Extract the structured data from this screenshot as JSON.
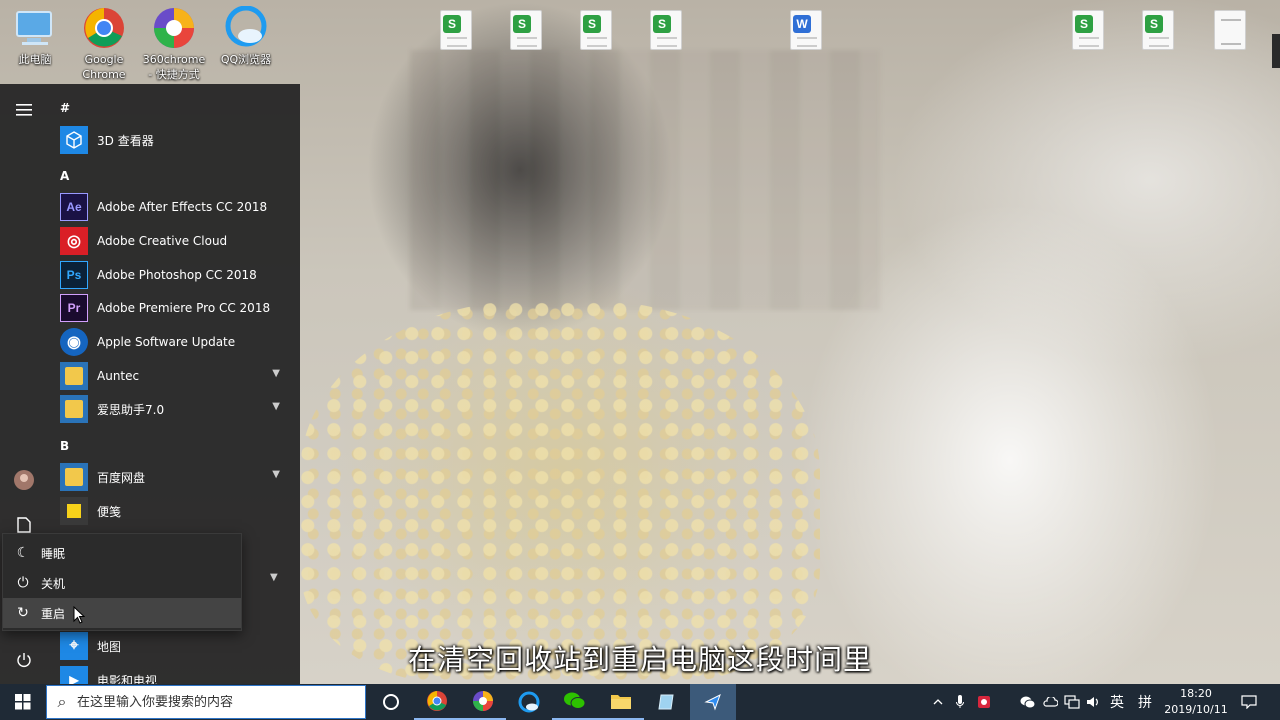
{
  "desktop": {
    "left_icons": [
      {
        "label": "此电脑",
        "icon": "computer-icon"
      },
      {
        "label": "Google Chrome",
        "icon": "chrome-icon"
      },
      {
        "label": "360chrome - 快捷方式",
        "icon": "360chrome-icon"
      },
      {
        "label": "QQ浏览器",
        "icon": "qq-browser-icon"
      }
    ],
    "docs": [
      {
        "badge": "S",
        "color": "#2ea043",
        "icon": "spreadsheet-file-icon"
      },
      {
        "badge": "S",
        "color": "#2ea043",
        "icon": "spreadsheet-file-icon"
      },
      {
        "badge": "S",
        "color": "#2ea043",
        "icon": "spreadsheet-file-icon"
      },
      {
        "badge": "S",
        "color": "#2ea043",
        "icon": "spreadsheet-file-icon"
      },
      {
        "badge": "W",
        "color": "#2f6fd6",
        "icon": "word-file-icon"
      },
      {
        "badge": "S",
        "color": "#2ea043",
        "icon": "spreadsheet-file-icon"
      },
      {
        "badge": "S",
        "color": "#2ea043",
        "icon": "spreadsheet-file-icon"
      },
      {
        "badge": "",
        "color": "#cccccc",
        "icon": "text-file-icon"
      }
    ]
  },
  "start_menu": {
    "groups": [
      {
        "header": "#",
        "apps": [
          {
            "label": "3D 查看器",
            "icon_text": "⬡",
            "icon_bg": "#1e88e5",
            "icon": "3d-viewer-icon",
            "expandable": false
          }
        ]
      },
      {
        "header": "A",
        "apps": [
          {
            "label": "Adobe After Effects CC 2018",
            "icon_text": "Ae",
            "icon_bg": "#1a1245",
            "icon_fg": "#9999ff",
            "icon": "after-effects-icon",
            "expandable": false
          },
          {
            "label": "Adobe Creative Cloud",
            "icon_text": "◎",
            "icon_bg": "#da1f26",
            "icon_fg": "#fff",
            "icon": "creative-cloud-icon",
            "expandable": false
          },
          {
            "label": "Adobe Photoshop CC 2018",
            "icon_text": "Ps",
            "icon_bg": "#0b2238",
            "icon_fg": "#31a8ff",
            "icon": "photoshop-icon",
            "expandable": false
          },
          {
            "label": "Adobe Premiere Pro CC 2018",
            "icon_text": "Pr",
            "icon_bg": "#1a0b2e",
            "icon_fg": "#d29ffc",
            "icon": "premiere-pro-icon",
            "expandable": false
          },
          {
            "label": "Apple Software Update",
            "icon_text": "◉",
            "icon_bg": "#1565c0",
            "icon_fg": "#fff",
            "icon": "apple-software-update-icon",
            "expandable": false
          },
          {
            "label": "Auntec",
            "icon_text": "",
            "icon_bg": "#f2c84b",
            "icon": "folder-icon",
            "expandable": true
          },
          {
            "label": "爱思助手7.0",
            "icon_text": "",
            "icon_bg": "#f2c84b",
            "icon": "folder-icon",
            "expandable": true
          }
        ]
      },
      {
        "header": "B",
        "apps": [
          {
            "label": "百度网盘",
            "icon_text": "",
            "icon_bg": "#f2c84b",
            "icon": "folder-icon",
            "expandable": true
          },
          {
            "label": "便笺",
            "icon_text": "▪",
            "icon_bg": "#f7d21a",
            "icon_fg": "#333",
            "icon": "sticky-notes-icon",
            "expandable": false
          }
        ]
      }
    ],
    "hidden_row_chevron": true,
    "bottom_apps": [
      {
        "label": "地图",
        "icon_text": "⌖",
        "icon_bg": "#1e88e5",
        "icon": "maps-icon"
      },
      {
        "label": "电影和电视",
        "icon_text": "▶",
        "icon_bg": "#1e88e5",
        "icon": "movies-tv-icon"
      }
    ],
    "power_menu": {
      "items": [
        {
          "label": "睡眠",
          "icon": "sleep-icon",
          "glyph": "☾"
        },
        {
          "label": "关机",
          "icon": "shutdown-icon",
          "glyph": "⏻"
        },
        {
          "label": "重启",
          "icon": "restart-icon",
          "glyph": "↻"
        }
      ],
      "hovered_index": 2
    }
  },
  "subtitle": "在清空回收站到重启电脑这段时间里",
  "taskbar": {
    "search_placeholder": "在这里输入你要搜索的内容",
    "apps": [
      "cortana-icon",
      "chrome-icon",
      "360chrome-icon",
      "edge-icon",
      "wechat-icon",
      "file-explorer-icon",
      "notepad-icon",
      "pin-app-icon"
    ],
    "tray": {
      "ime": "英",
      "ime2": "拼",
      "time": "18:20",
      "date": "2019/10/11"
    }
  }
}
